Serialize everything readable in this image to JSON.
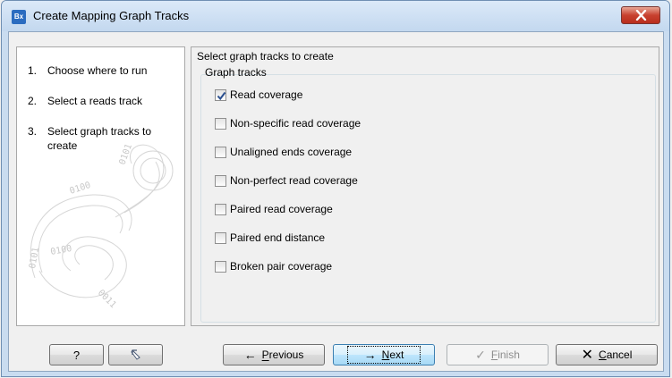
{
  "window": {
    "title": "Create Mapping Graph Tracks",
    "app_icon_text": "Bx"
  },
  "steps": [
    {
      "num": "1.",
      "label": "Choose where to run"
    },
    {
      "num": "2.",
      "label": "Select a reads track"
    },
    {
      "num": "3.",
      "label": "Select graph tracks to create"
    }
  ],
  "content": {
    "heading": "Select graph tracks to create",
    "group_label": "Graph tracks",
    "checkboxes": [
      {
        "label": "Read coverage",
        "checked": true
      },
      {
        "label": "Non-specific read coverage",
        "checked": false
      },
      {
        "label": "Unaligned ends coverage",
        "checked": false
      },
      {
        "label": "Non-perfect read coverage",
        "checked": false
      },
      {
        "label": "Paired read coverage",
        "checked": false
      },
      {
        "label": "Paired end distance",
        "checked": false
      },
      {
        "label": "Broken pair coverage",
        "checked": false
      }
    ]
  },
  "buttons": {
    "help": "?",
    "previous": "Previous",
    "previous_mnemonic": "P",
    "next": "Next",
    "next_mnemonic": "N",
    "finish": "Finish",
    "finish_mnemonic": "F",
    "cancel": "Cancel",
    "cancel_mnemonic": "C"
  },
  "icons": {
    "help": "question-mark",
    "reset": "reset-arrow-icon",
    "previous": "arrow-left-icon",
    "next": "arrow-right-icon",
    "finish": "checkmark-icon",
    "cancel": "x-icon"
  },
  "colors": {
    "titlebar": "#c9dcf0",
    "close_button": "#c8412f",
    "next_button": "#bee6fd",
    "cancel_icon": "#000000"
  }
}
